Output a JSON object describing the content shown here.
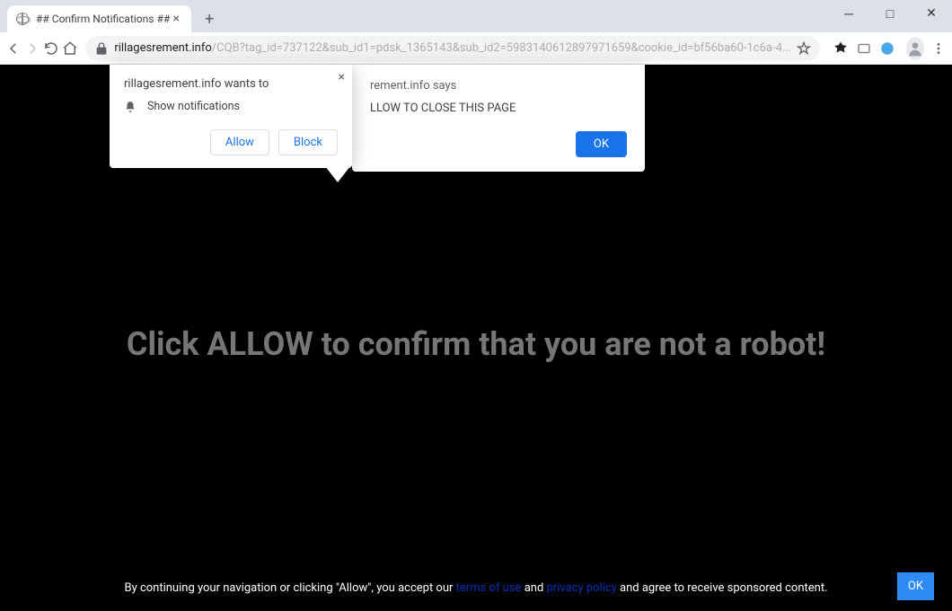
{
  "window": {
    "tab_title": "## Confirm Notifications ##"
  },
  "toolbar": {
    "url_host": "rillagesrement.info",
    "url_path": "/CQB?tag_id=737122&sub_id1=pdsk_1365143&sub_id2=5983140612897971659&cookie_id=bf56ba60-1c6a-4..."
  },
  "permission": {
    "title": "rillagesrement.info wants to",
    "item": "Show notifications",
    "allow": "Allow",
    "block": "Block"
  },
  "alert": {
    "title": "rement.info says",
    "body": "LLOW TO CLOSE THIS PAGE",
    "ok": "OK"
  },
  "page": {
    "hero": "Click ALLOW to confirm that you are not a robot!",
    "footer_pre": "By continuing your navigation or clicking \"Allow\", you accept our ",
    "terms": "terms of use",
    "and": " and ",
    "privacy": "privacy policy",
    "footer_post": " and agree to receive sponsored content.",
    "footer_ok": "OK"
  }
}
